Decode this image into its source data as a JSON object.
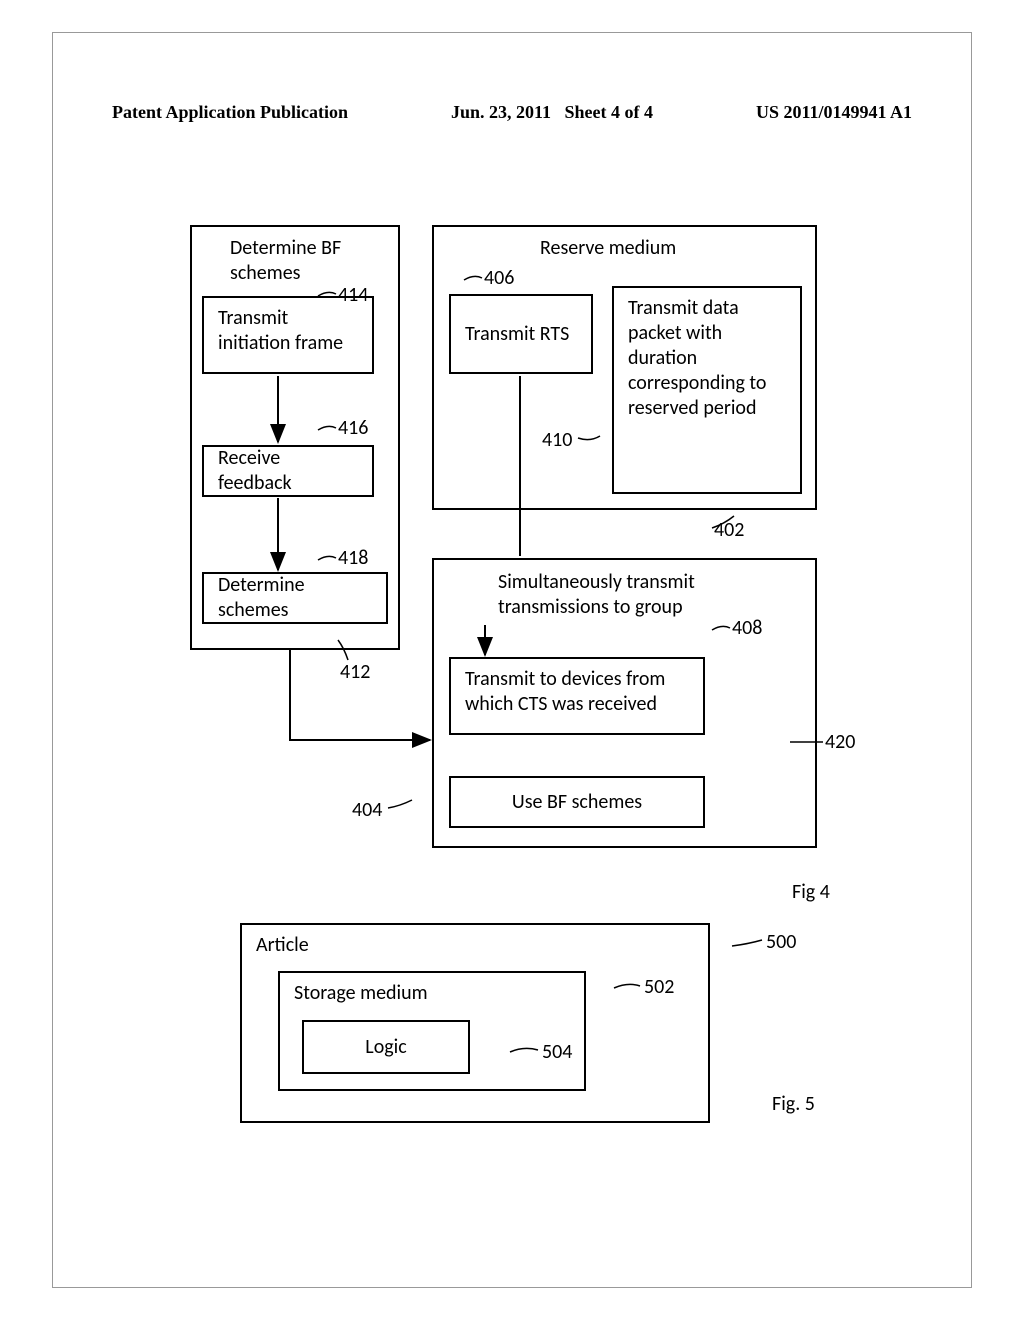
{
  "header": {
    "left": "Patent Application Publication",
    "center": "Jun. 23, 2011",
    "sheet": "Sheet 4 of 4",
    "right": "US 2011/0149941 A1"
  },
  "fig4": {
    "box412": {
      "title": "Determine BF schemes",
      "label": "412"
    },
    "box414": {
      "text": "Transmit initiation frame",
      "label": "414"
    },
    "box416": {
      "text": "Receive feedback",
      "label": "416"
    },
    "box418": {
      "text": "Determine schemes",
      "label": "418"
    },
    "box402": {
      "title": "Reserve medium",
      "label": "402"
    },
    "box406": {
      "text": "Transmit RTS",
      "label": "406"
    },
    "box410": {
      "text": "Transmit data packet with duration corresponding to reserved period",
      "label": "410"
    },
    "box404": {
      "title": "Simultaneously transmit transmissions to group",
      "label": "404"
    },
    "box408": {
      "text": "Transmit to devices from which CTS was received",
      "label": "408"
    },
    "box420": {
      "text": "Use BF schemes",
      "label": "420"
    },
    "caption": "Fig 4"
  },
  "fig5": {
    "box500": {
      "text": "Article",
      "label": "500"
    },
    "box502": {
      "text": "Storage medium",
      "label": "502"
    },
    "box504": {
      "text": "Logic",
      "label": "504"
    },
    "caption": "Fig. 5"
  }
}
